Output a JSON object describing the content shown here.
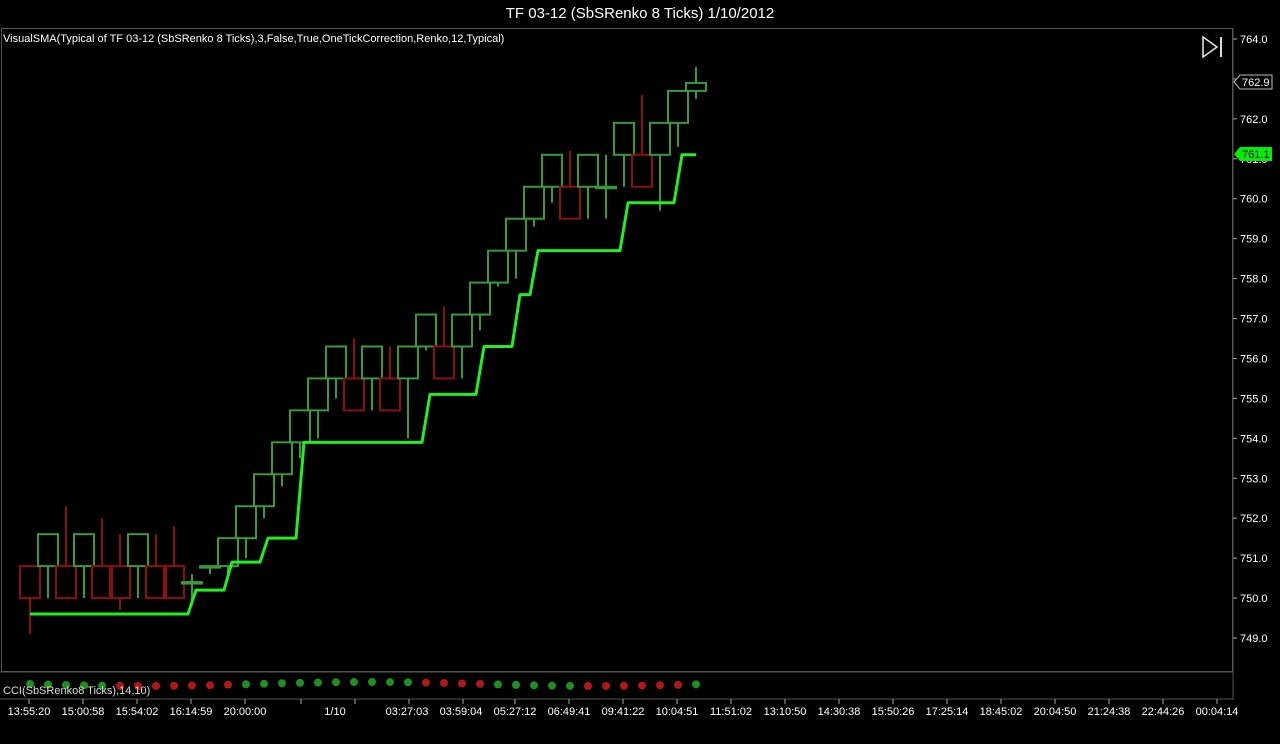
{
  "window": {
    "title": "TF 03-12 (SbSRenko 8 Ticks)  1/10/2012"
  },
  "main_pane": {
    "indicator_label": "VisualSMA(Typical of TF 03-12 (SbSRenko 8 Ticks),3,False,True,OneTickCorrection,Renko,12,Typical)",
    "price_tag_last": "762.9",
    "price_tag_sma": "761.1"
  },
  "sub_pane": {
    "label": "CCI(SbSRenko8 Ticks),14,10)"
  },
  "icons": {
    "play_end": "play-to-end-icon"
  },
  "colors": {
    "background": "#000000",
    "up_candle": "#3a9a3a",
    "down_candle": "#8b1010",
    "sma_line": "#22ee22",
    "dot_green": "#1f8f1f",
    "dot_red": "#b01818",
    "tag_green": "#00ee00"
  },
  "chart_data": {
    "type": "candlestick",
    "ylim": [
      748.3,
      764.3
    ],
    "y_ticks": [
      749.0,
      750.0,
      751.0,
      752.0,
      753.0,
      754.0,
      755.0,
      756.0,
      757.0,
      758.0,
      759.0,
      760.0,
      761.0,
      762.0,
      763.0,
      764.0
    ],
    "x_tick_labels": [
      "13:55:20",
      "15:00:58",
      "15:54:02",
      "16:14:59",
      "20:00:00",
      "1/10",
      "03:27:03",
      "03:59:04",
      "05:27:12",
      "06:49:41",
      "09:41:22",
      "10:04:51",
      "11:51:02",
      "13:10:50",
      "14:30:38",
      "15:50:26",
      "17:25:14",
      "18:45:02",
      "20:04:50",
      "21:24:38",
      "22:44:26",
      "00:04:14"
    ],
    "series": [
      {
        "name": "TF 03-12 (SbSRenko 8 Ticks)",
        "bars": [
          {
            "o": 750.8,
            "h": 750.8,
            "l": 749.1,
            "c": 750.0
          },
          {
            "o": 750.8,
            "h": 751.6,
            "l": 750.0,
            "c": 751.6
          },
          {
            "o": 750.8,
            "h": 752.3,
            "l": 750.0,
            "c": 750.0
          },
          {
            "o": 750.8,
            "h": 751.6,
            "l": 750.0,
            "c": 751.6
          },
          {
            "o": 750.8,
            "h": 752.0,
            "l": 750.0,
            "c": 750.0
          },
          {
            "o": 750.8,
            "h": 751.6,
            "l": 749.7,
            "c": 750.0
          },
          {
            "o": 750.8,
            "h": 751.6,
            "l": 750.0,
            "c": 751.6
          },
          {
            "o": 750.8,
            "h": 751.6,
            "l": 750.0,
            "c": 750.0
          },
          {
            "o": 750.8,
            "h": 751.8,
            "l": 750.0,
            "c": 750.0
          },
          {
            "o": 750.4,
            "h": 750.6,
            "l": 749.9,
            "c": 750.4
          },
          {
            "o": 750.8,
            "h": 750.8,
            "l": 750.6,
            "c": 750.8
          },
          {
            "o": 750.8,
            "h": 751.5,
            "l": 750.6,
            "c": 751.5
          },
          {
            "o": 751.5,
            "h": 752.3,
            "l": 751.0,
            "c": 752.3
          },
          {
            "o": 752.3,
            "h": 753.1,
            "l": 752.0,
            "c": 753.1
          },
          {
            "o": 753.1,
            "h": 753.9,
            "l": 752.8,
            "c": 753.9
          },
          {
            "o": 753.9,
            "h": 754.7,
            "l": 753.5,
            "c": 754.7
          },
          {
            "o": 754.7,
            "h": 755.5,
            "l": 754.0,
            "c": 755.5
          },
          {
            "o": 755.5,
            "h": 756.3,
            "l": 755.0,
            "c": 756.3
          },
          {
            "o": 755.5,
            "h": 756.5,
            "l": 754.7,
            "c": 754.7
          },
          {
            "o": 755.5,
            "h": 756.3,
            "l": 754.7,
            "c": 756.3
          },
          {
            "o": 755.5,
            "h": 756.3,
            "l": 754.7,
            "c": 754.7
          },
          {
            "o": 755.5,
            "h": 756.3,
            "l": 754.0,
            "c": 756.3
          },
          {
            "o": 756.3,
            "h": 757.1,
            "l": 756.2,
            "c": 757.1
          },
          {
            "o": 756.3,
            "h": 757.3,
            "l": 755.5,
            "c": 755.5
          },
          {
            "o": 756.3,
            "h": 757.1,
            "l": 755.5,
            "c": 757.1
          },
          {
            "o": 757.1,
            "h": 757.9,
            "l": 756.7,
            "c": 757.9
          },
          {
            "o": 757.9,
            "h": 758.7,
            "l": 757.8,
            "c": 758.7
          },
          {
            "o": 758.7,
            "h": 759.5,
            "l": 758.0,
            "c": 759.5
          },
          {
            "o": 759.5,
            "h": 760.3,
            "l": 759.3,
            "c": 760.3
          },
          {
            "o": 760.3,
            "h": 761.1,
            "l": 759.9,
            "c": 761.1
          },
          {
            "o": 760.3,
            "h": 761.2,
            "l": 759.5,
            "c": 759.5
          },
          {
            "o": 760.3,
            "h": 761.1,
            "l": 759.5,
            "c": 761.1
          },
          {
            "o": 760.3,
            "h": 761.1,
            "l": 759.5,
            "c": 760.3
          },
          {
            "o": 761.1,
            "h": 761.9,
            "l": 760.3,
            "c": 761.9
          },
          {
            "o": 761.1,
            "h": 762.6,
            "l": 760.3,
            "c": 760.3
          },
          {
            "o": 761.1,
            "h": 761.9,
            "l": 759.7,
            "c": 761.9
          },
          {
            "o": 761.9,
            "h": 762.7,
            "l": 761.3,
            "c": 762.7
          },
          {
            "o": 762.7,
            "h": 763.3,
            "l": 762.5,
            "c": 762.9
          }
        ]
      },
      {
        "name": "VisualSMA",
        "values": [
          749.6,
          749.6,
          749.6,
          749.6,
          749.6,
          749.6,
          749.6,
          749.6,
          749.6,
          750.2,
          750.2,
          750.9,
          750.9,
          751.5,
          751.5,
          753.9,
          753.9,
          753.9,
          753.9,
          753.9,
          753.9,
          753.9,
          755.1,
          755.1,
          755.1,
          756.3,
          756.3,
          757.6,
          758.7,
          758.7,
          758.7,
          758.7,
          758.7,
          759.9,
          759.9,
          759.9,
          761.1,
          761.1
        ]
      },
      {
        "name": "CCI",
        "dots": [
          "G",
          "G",
          "G",
          "G",
          "G",
          "R",
          "R",
          "R",
          "R",
          "R",
          "R",
          "R",
          "G",
          "G",
          "G",
          "G",
          "G",
          "G",
          "G",
          "G",
          "G",
          "G",
          "R",
          "R",
          "R",
          "R",
          "G",
          "G",
          "G",
          "G",
          "G",
          "R",
          "R",
          "R",
          "R",
          "R",
          "R",
          "G"
        ]
      }
    ]
  }
}
